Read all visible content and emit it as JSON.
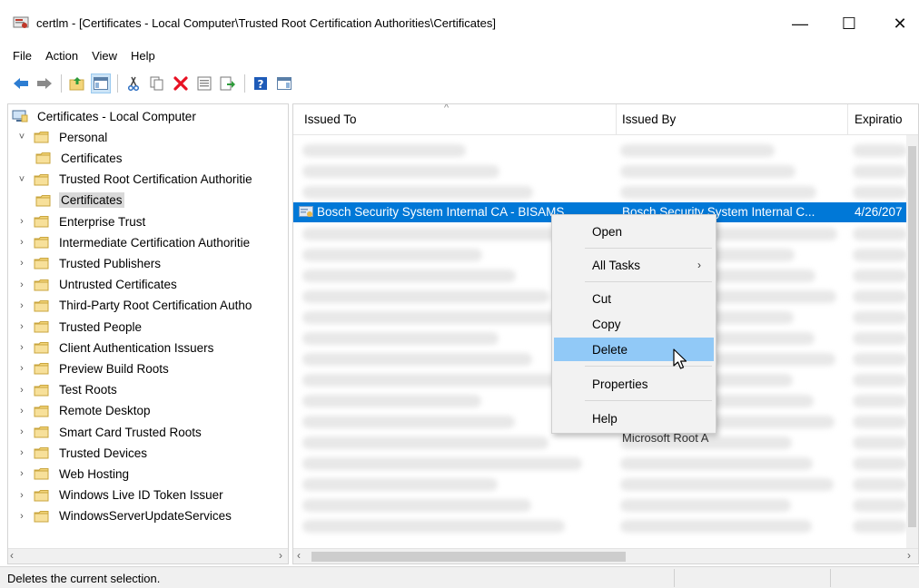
{
  "window": {
    "title": "certlm - [Certificates - Local Computer\\Trusted Root Certification Authorities\\Certificates]",
    "min_glyph": "—",
    "max_glyph": "☐",
    "close_glyph": "✕"
  },
  "menu": [
    "File",
    "Action",
    "View",
    "Help"
  ],
  "toolbar": {
    "icons": [
      "back-arrow-icon",
      "forward-arrow-icon",
      "up-folder-icon",
      "show-hide-console-tree-icon",
      "cut-icon",
      "copy-icon",
      "delete-icon",
      "properties-icon",
      "export-list-icon",
      "help-icon",
      "action-pane-icon"
    ]
  },
  "tree": {
    "items": [
      {
        "label": "Certificates - Local Computer",
        "level": 0,
        "expander": "",
        "icon": "computer"
      },
      {
        "label": "Personal",
        "level": 1,
        "expander": "˅",
        "icon": "folder"
      },
      {
        "label": "Certificates",
        "level": 2,
        "expander": "",
        "icon": "folder"
      },
      {
        "label": "Trusted Root Certification Authoritie",
        "level": 1,
        "expander": "˅",
        "icon": "folder"
      },
      {
        "label": "Certificates",
        "level": 2,
        "expander": "",
        "icon": "folder",
        "selected": true
      },
      {
        "label": "Enterprise Trust",
        "level": 1,
        "expander": "›",
        "icon": "folder"
      },
      {
        "label": "Intermediate Certification Authoritie",
        "level": 1,
        "expander": "›",
        "icon": "folder"
      },
      {
        "label": "Trusted Publishers",
        "level": 1,
        "expander": "›",
        "icon": "folder"
      },
      {
        "label": "Untrusted Certificates",
        "level": 1,
        "expander": "›",
        "icon": "folder"
      },
      {
        "label": "Third-Party Root Certification Autho",
        "level": 1,
        "expander": "›",
        "icon": "folder"
      },
      {
        "label": "Trusted People",
        "level": 1,
        "expander": "›",
        "icon": "folder"
      },
      {
        "label": "Client Authentication Issuers",
        "level": 1,
        "expander": "›",
        "icon": "folder"
      },
      {
        "label": "Preview Build Roots",
        "level": 1,
        "expander": "›",
        "icon": "folder"
      },
      {
        "label": "Test Roots",
        "level": 1,
        "expander": "›",
        "icon": "folder"
      },
      {
        "label": "Remote Desktop",
        "level": 1,
        "expander": "›",
        "icon": "folder"
      },
      {
        "label": "Smart Card Trusted Roots",
        "level": 1,
        "expander": "›",
        "icon": "folder"
      },
      {
        "label": "Trusted Devices",
        "level": 1,
        "expander": "›",
        "icon": "folder"
      },
      {
        "label": "Web Hosting",
        "level": 1,
        "expander": "›",
        "icon": "folder"
      },
      {
        "label": "Windows Live ID Token Issuer",
        "level": 1,
        "expander": "›",
        "icon": "folder"
      },
      {
        "label": "WindowsServerUpdateServices",
        "level": 1,
        "expander": "›",
        "icon": "folder"
      }
    ]
  },
  "list": {
    "columns": {
      "issued_to": "Issued To",
      "issued_by": "Issued By",
      "expiration": "Expiratio"
    },
    "selected_row": {
      "issued_to": "Bosch Security System Internal CA - BISAMS",
      "issued_by": "Bosch Security System Internal C...",
      "expiration": "4/26/207"
    },
    "partial_visible_text": "Microsoft Root A"
  },
  "context_menu": {
    "items": [
      {
        "label": "Open",
        "submenu": false
      },
      {
        "label": "All Tasks",
        "submenu": true
      },
      {
        "label": "Cut",
        "submenu": false
      },
      {
        "label": "Copy",
        "submenu": false
      },
      {
        "label": "Delete",
        "submenu": false,
        "highlighted": true
      },
      {
        "label": "Properties",
        "submenu": false
      },
      {
        "label": "Help",
        "submenu": false
      }
    ]
  },
  "status": {
    "text": "Deletes the current selection."
  },
  "colors": {
    "selection_blue": "#0078d7",
    "menu_highlight": "#91c9f7",
    "folder_yellow": "#f3d57a",
    "delete_red": "#e81123"
  }
}
